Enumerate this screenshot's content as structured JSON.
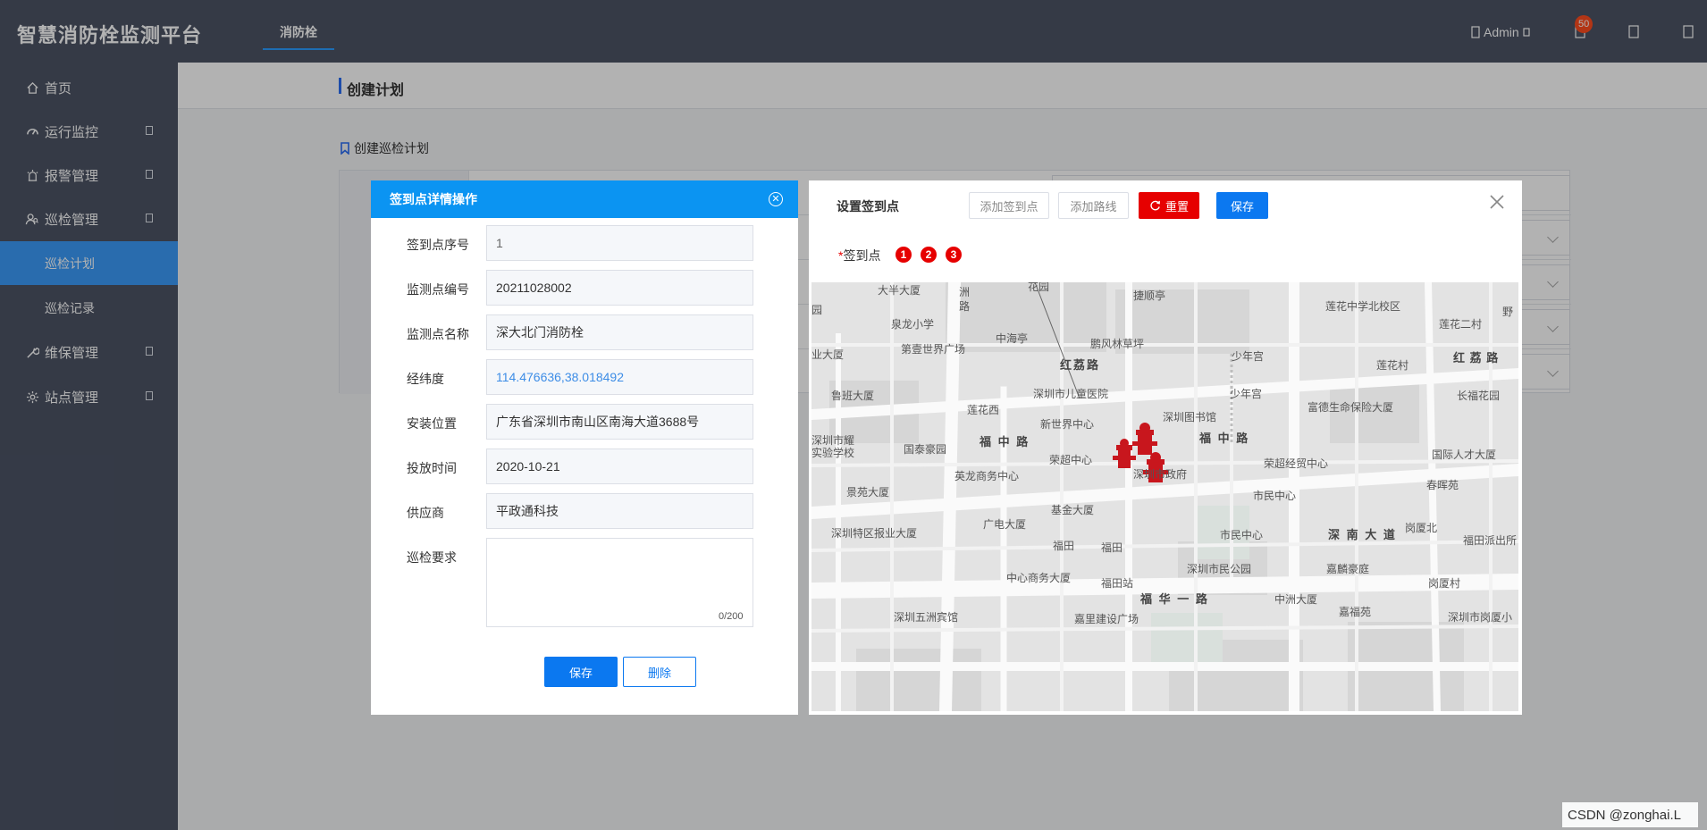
{
  "header": {
    "brand": "智慧消防栓监测平台",
    "active_tab": "消防栓",
    "user": "Admin",
    "notification_count": "50",
    "colors": {
      "bar": "#4c5365",
      "accent": "#2a9dff"
    }
  },
  "sidebar": {
    "items": [
      {
        "label": "首页",
        "icon": "home-icon",
        "has_children": false
      },
      {
        "label": "运行监控",
        "icon": "dashboard-icon",
        "has_children": true
      },
      {
        "label": "报警管理",
        "icon": "alarm-icon",
        "has_children": true
      },
      {
        "label": "巡检管理",
        "icon": "patrol-icon",
        "has_children": true,
        "expanded": true,
        "children": [
          {
            "label": "巡检计划",
            "active": true
          },
          {
            "label": "巡检记录",
            "active": false
          }
        ]
      },
      {
        "label": "维保管理",
        "icon": "wrench-icon",
        "has_children": true
      },
      {
        "label": "站点管理",
        "icon": "gear-icon",
        "has_children": true
      }
    ]
  },
  "page": {
    "title": "创建计划",
    "section_title": "创建巡检计划"
  },
  "detail_dialog": {
    "title": "签到点详情操作",
    "fields": [
      {
        "label": "签到点序号",
        "value": "1"
      },
      {
        "label": "监测点编号",
        "value": "20211028002"
      },
      {
        "label": "监测点名称",
        "value": "深大北门消防栓"
      },
      {
        "label": "经纬度",
        "value": "114.476636,38.018492"
      },
      {
        "label": "安装位置",
        "value": "广东省深圳市南山区南海大道3688号"
      },
      {
        "label": "投放时间",
        "value": "2020-10-21"
      },
      {
        "label": "供应商",
        "value": "平政通科技"
      },
      {
        "label": "巡检要求",
        "value": ""
      }
    ],
    "requirement_counter": "0/200",
    "save_label": "保存",
    "delete_label": "删除"
  },
  "checkpoint_dialog": {
    "title": "设置签到点",
    "add_point_label": "添加签到点",
    "add_route_label": "添加路线",
    "reset_label": "重置",
    "save_label": "保存",
    "points_label": "签到点",
    "points": [
      "1",
      "2",
      "3"
    ],
    "colors": {
      "reset": "#e60000",
      "save": "#0b78f0",
      "marker": "#c8161d"
    }
  },
  "map": {
    "labels": [
      "大半大厦",
      "洲",
      "路",
      "花园",
      "捷顺亭",
      "莲花中学北校区",
      "莲花二村",
      "野",
      "园",
      "泉龙小学",
      "第壹世界广场",
      "中海亭",
      "鹏风林草坪",
      "少年宫",
      "莲花村",
      "红荔路",
      "红 荔 路",
      "业大厦",
      "鲁班大厦",
      "深圳市儿童医院",
      "少年宫",
      "长福花园",
      "莲花西",
      "新世界中心",
      "深圳图书馆",
      "富德生命保险大厦",
      "深圳市耀",
      "实验学校",
      "国泰豪园",
      "福 中 路",
      "福 中 路",
      "荣超中心",
      "深圳市政府",
      "荣超经贸中心",
      "国际人才大厦",
      "英龙商务中心",
      "景苑大厦",
      "市民中心",
      "春晖苑",
      "基金大厦",
      "广电大厦",
      "深圳特区报业大厦",
      "市民中心",
      "深 南 大 道",
      "岗厦北",
      "福田派出所",
      "福田",
      "福田",
      "中心商务大厦",
      "深圳市民公园",
      "嘉麟豪庭",
      "福田站",
      "岗厦村",
      "福 华 一 路",
      "中洲大厦",
      "嘉福苑",
      "深圳五洲宾馆",
      "嘉里建设广场",
      "深圳市岗厦小"
    ]
  },
  "watermark": "CSDN @zonghai.L"
}
